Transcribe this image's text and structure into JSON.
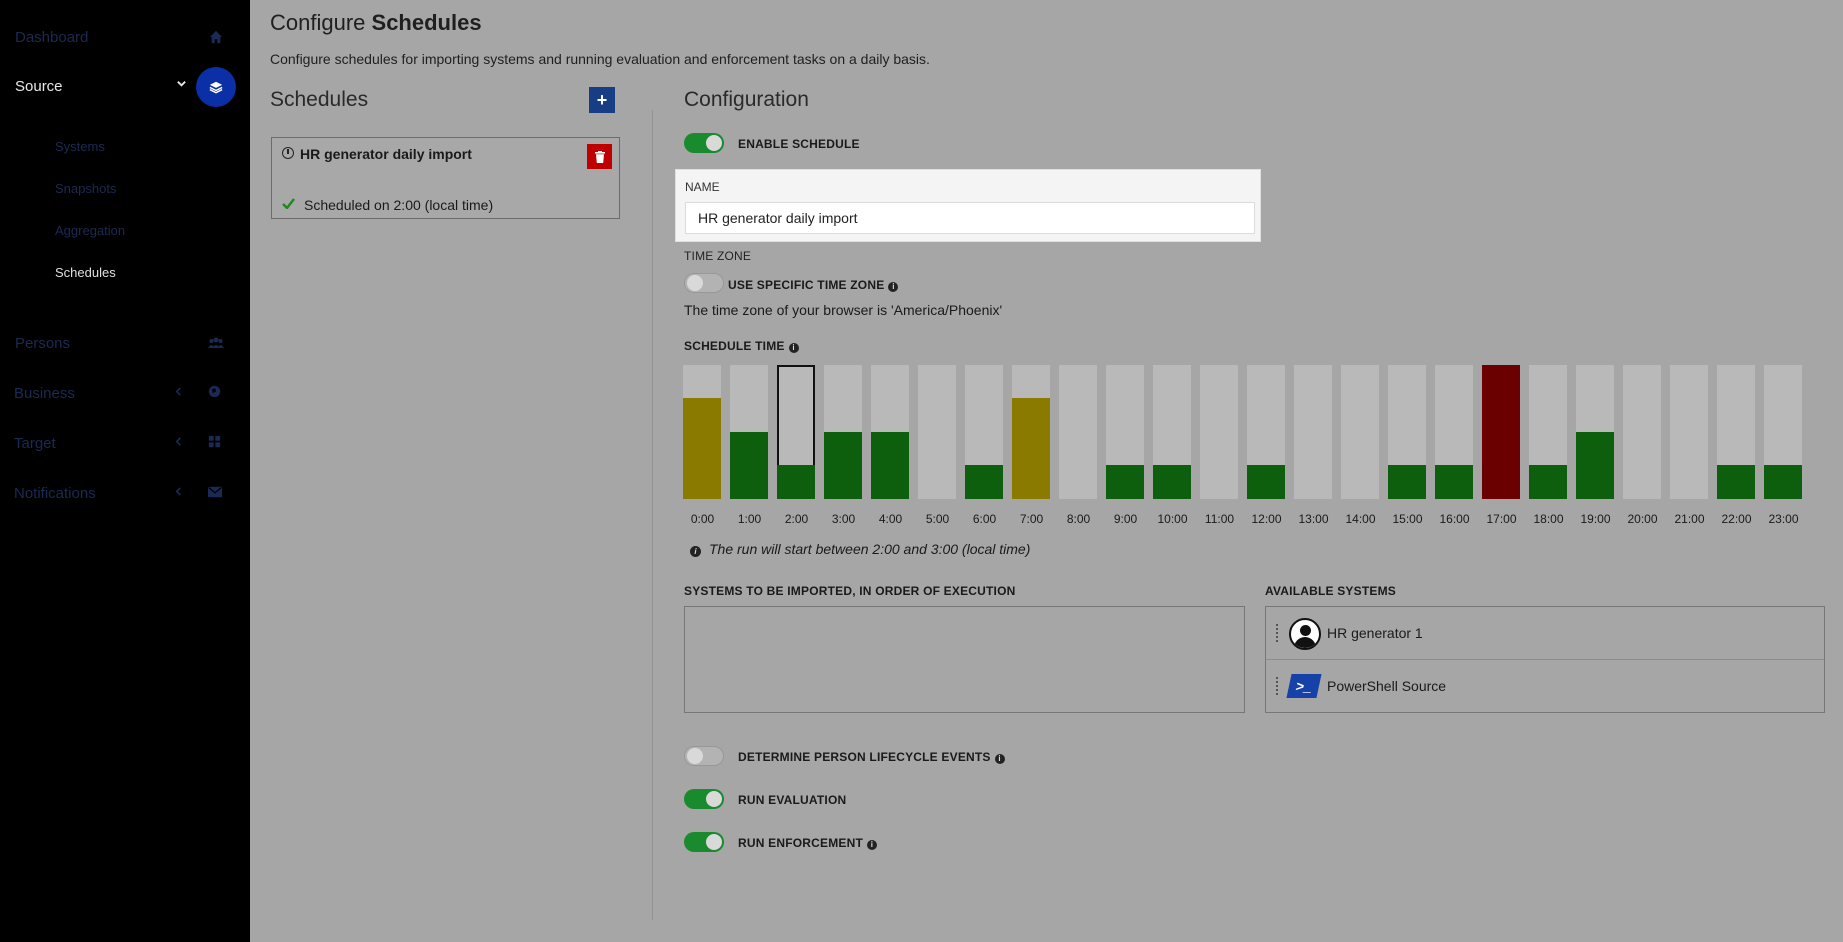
{
  "sidebar": {
    "dashboard": "Dashboard",
    "source": "Source",
    "source_sub": [
      "Systems",
      "Snapshots",
      "Aggregation",
      "Schedules"
    ],
    "persons": "Persons",
    "business": "Business",
    "target": "Target",
    "notifications": "Notifications"
  },
  "header": {
    "title_light": "Configure",
    "title_bold": "Schedules",
    "description": "Configure schedules for importing systems and running evaluation and enforcement tasks on a daily basis."
  },
  "schedules": {
    "title": "Schedules",
    "add_label": "+",
    "items": [
      {
        "name": "HR generator daily import",
        "status": "Scheduled on 2:00 (local time)"
      }
    ]
  },
  "config": {
    "title": "Configuration",
    "enable_schedule": "ENABLE SCHEDULE",
    "name_label": "NAME",
    "name_value": "HR generator daily import",
    "time_zone_label": "TIME ZONE",
    "use_specific_tz": "USE SPECIFIC TIME ZONE",
    "tz_note": "The time zone of your browser is 'America/Phoenix'",
    "schedule_time_label": "SCHEDULE TIME",
    "run_note": "The run will start between 2:00 and 3:00 (local time)",
    "systems_label": "SYSTEMS TO BE IMPORTED, IN ORDER OF EXECUTION",
    "available_label": "AVAILABLE SYSTEMS",
    "available_systems": [
      "HR generator 1",
      "PowerShell Source"
    ],
    "lifecycle_label": "DETERMINE PERSON LIFECYCLE EVENTS",
    "run_evaluation": "RUN EVALUATION",
    "run_enforcement": "RUN ENFORCEMENT",
    "toggles": {
      "enable_schedule": true,
      "use_specific_tz": false,
      "lifecycle": false,
      "run_evaluation": true,
      "run_enforcement": true
    }
  },
  "colors": {
    "accent": "#0a2fa6",
    "green": "#0d5e0d",
    "yellow": "#8a7a00",
    "red": "#6b0000",
    "empty": "#b9b9b9"
  },
  "chart_data": {
    "type": "bar",
    "categories": [
      "0:00",
      "1:00",
      "2:00",
      "3:00",
      "4:00",
      "5:00",
      "6:00",
      "7:00",
      "8:00",
      "9:00",
      "10:00",
      "11:00",
      "12:00",
      "13:00",
      "14:00",
      "15:00",
      "16:00",
      "17:00",
      "18:00",
      "19:00",
      "20:00",
      "21:00",
      "22:00",
      "23:00"
    ],
    "values": [
      0.75,
      0.5,
      0.25,
      0.5,
      0.5,
      0,
      0.25,
      0.75,
      0,
      0.25,
      0.25,
      0,
      0.25,
      0,
      0,
      0.25,
      0.25,
      1,
      0.25,
      0.5,
      0,
      0,
      0.25,
      0.25
    ],
    "levels": [
      "yellow",
      "green",
      "green",
      "green",
      "green",
      "none",
      "green",
      "yellow",
      "none",
      "green",
      "green",
      "none",
      "green",
      "none",
      "none",
      "green",
      "green",
      "red",
      "green",
      "green",
      "none",
      "none",
      "green",
      "green"
    ],
    "selected_index": 2
  }
}
